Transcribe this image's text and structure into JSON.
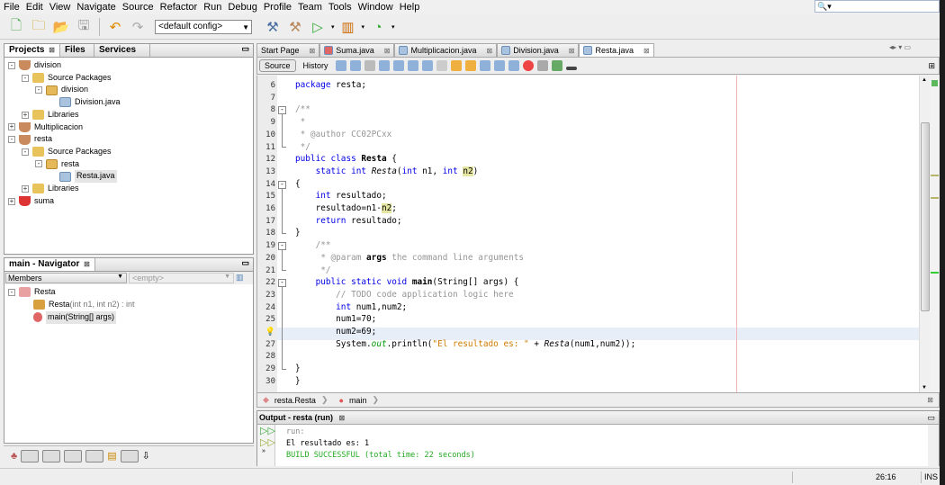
{
  "menu": [
    "File",
    "Edit",
    "View",
    "Navigate",
    "Source",
    "Refactor",
    "Run",
    "Debug",
    "Profile",
    "Team",
    "Tools",
    "Window",
    "Help"
  ],
  "toolbar": {
    "config": "<default config>"
  },
  "projects": {
    "tabs": [
      "Projects",
      "Files",
      "Services"
    ],
    "tree": [
      {
        "label": "division",
        "level": 0,
        "icon": "project",
        "toggle": "-"
      },
      {
        "label": "Source Packages",
        "level": 1,
        "icon": "folder",
        "toggle": "-"
      },
      {
        "label": "division",
        "level": 2,
        "icon": "package",
        "toggle": "-"
      },
      {
        "label": "Division.java",
        "level": 3,
        "icon": "java",
        "toggle": ""
      },
      {
        "label": "Libraries",
        "level": 1,
        "icon": "library",
        "toggle": "+"
      },
      {
        "label": "Multiplicacion",
        "level": 0,
        "icon": "project",
        "toggle": "+"
      },
      {
        "label": "resta",
        "level": 0,
        "icon": "project",
        "toggle": "-"
      },
      {
        "label": "Source Packages",
        "level": 1,
        "icon": "folder",
        "toggle": "-"
      },
      {
        "label": "resta",
        "level": 2,
        "icon": "package",
        "toggle": "-"
      },
      {
        "label": "Resta.java",
        "level": 3,
        "icon": "java",
        "toggle": "",
        "selected": true
      },
      {
        "label": "Libraries",
        "level": 1,
        "icon": "library",
        "toggle": "+"
      },
      {
        "label": "suma",
        "level": 0,
        "icon": "project-error",
        "toggle": "+"
      }
    ]
  },
  "navigator": {
    "title": "main - Navigator",
    "filter": "Members",
    "empty": "<empty>",
    "root": "Resta",
    "items": [
      {
        "name": "Resta",
        "params": "(int n1, int n2) : int"
      },
      {
        "name": "main(String[] args)",
        "params": ""
      }
    ]
  },
  "editor": {
    "tabs": [
      "Start Page",
      "Suma.java",
      "Multiplicacion.java",
      "Division.java",
      "Resta.java"
    ],
    "source": "Source",
    "history": "History",
    "lines": [
      {
        "n": "6",
        "t": [
          [
            "package",
            "kw"
          ],
          [
            " resta;",
            ""
          ]
        ]
      },
      {
        "n": "7",
        "t": []
      },
      {
        "n": "8",
        "t": [
          [
            "/**",
            "cm"
          ]
        ]
      },
      {
        "n": "9",
        "t": [
          [
            " *",
            "cm"
          ]
        ]
      },
      {
        "n": "10",
        "t": [
          [
            " * @author CC02PCxx",
            "cm"
          ]
        ]
      },
      {
        "n": "11",
        "t": [
          [
            " */",
            "cm"
          ]
        ]
      },
      {
        "n": "12",
        "t": [
          [
            "public class",
            "kw"
          ],
          [
            " ",
            ""
          ],
          [
            "Resta",
            "bold"
          ],
          [
            " {",
            ""
          ]
        ]
      },
      {
        "n": "13",
        "t": [
          [
            "    static int",
            "kw"
          ],
          [
            " ",
            ""
          ],
          [
            "Resta",
            "ital"
          ],
          [
            "(",
            ""
          ],
          [
            "int",
            "kw"
          ],
          [
            " n1, ",
            ""
          ],
          [
            "int",
            "kw"
          ],
          [
            " ",
            ""
          ],
          [
            "n2",
            "hl"
          ],
          [
            ")",
            ""
          ]
        ]
      },
      {
        "n": "14",
        "t": [
          [
            "{",
            ""
          ]
        ]
      },
      {
        "n": "15",
        "t": [
          [
            "    int",
            "kw"
          ],
          [
            " resultado;",
            ""
          ]
        ]
      },
      {
        "n": "16",
        "t": [
          [
            "    resultado=n1-",
            ""
          ],
          [
            "n2",
            "hl"
          ],
          [
            ";",
            ""
          ]
        ]
      },
      {
        "n": "17",
        "t": [
          [
            "    return",
            "kw"
          ],
          [
            " resultado;",
            ""
          ]
        ]
      },
      {
        "n": "18",
        "t": [
          [
            "}",
            ""
          ]
        ]
      },
      {
        "n": "19",
        "t": [
          [
            "    /**",
            "cm"
          ]
        ]
      },
      {
        "n": "20",
        "t": [
          [
            "     * @param ",
            "cm"
          ],
          [
            "args",
            "bold"
          ],
          [
            " the command line arguments",
            "cm"
          ]
        ]
      },
      {
        "n": "21",
        "t": [
          [
            "     */",
            "cm"
          ]
        ]
      },
      {
        "n": "22",
        "t": [
          [
            "    public static void",
            "kw"
          ],
          [
            " ",
            ""
          ],
          [
            "main",
            "bold"
          ],
          [
            "(String[] args) {",
            ""
          ]
        ]
      },
      {
        "n": "23",
        "t": [
          [
            "        // TODO code application logic here",
            "cm"
          ]
        ]
      },
      {
        "n": "24",
        "t": [
          [
            "        int",
            "kw"
          ],
          [
            " num1,num2;",
            ""
          ]
        ]
      },
      {
        "n": "25",
        "t": [
          [
            "        num1=70;",
            ""
          ]
        ]
      },
      {
        "n": "",
        "t": [
          [
            "        num2=69;",
            ""
          ]
        ]
      },
      {
        "n": "27",
        "t": [
          [
            "        System.",
            ""
          ],
          [
            "out",
            "fld"
          ],
          [
            ".println(",
            ""
          ],
          [
            "\"El resultado es: \"",
            "st"
          ],
          [
            " + ",
            ""
          ],
          [
            "Resta",
            "ital"
          ],
          [
            "(num1,num2));",
            ""
          ]
        ]
      },
      {
        "n": "28",
        "t": []
      },
      {
        "n": "29",
        "t": [
          [
            "}",
            ""
          ]
        ]
      },
      {
        "n": "30",
        "t": [
          [
            "}",
            ""
          ]
        ]
      }
    ]
  },
  "breadcrumb": [
    "resta.Resta",
    "main"
  ],
  "output": {
    "title": "Output - resta (run)",
    "lines": [
      "run:",
      "El resultado es: 1",
      "BUILD SUCCESSFUL (total time: 22 seconds)"
    ]
  },
  "status": {
    "position": "26:16",
    "mode": "INS"
  }
}
